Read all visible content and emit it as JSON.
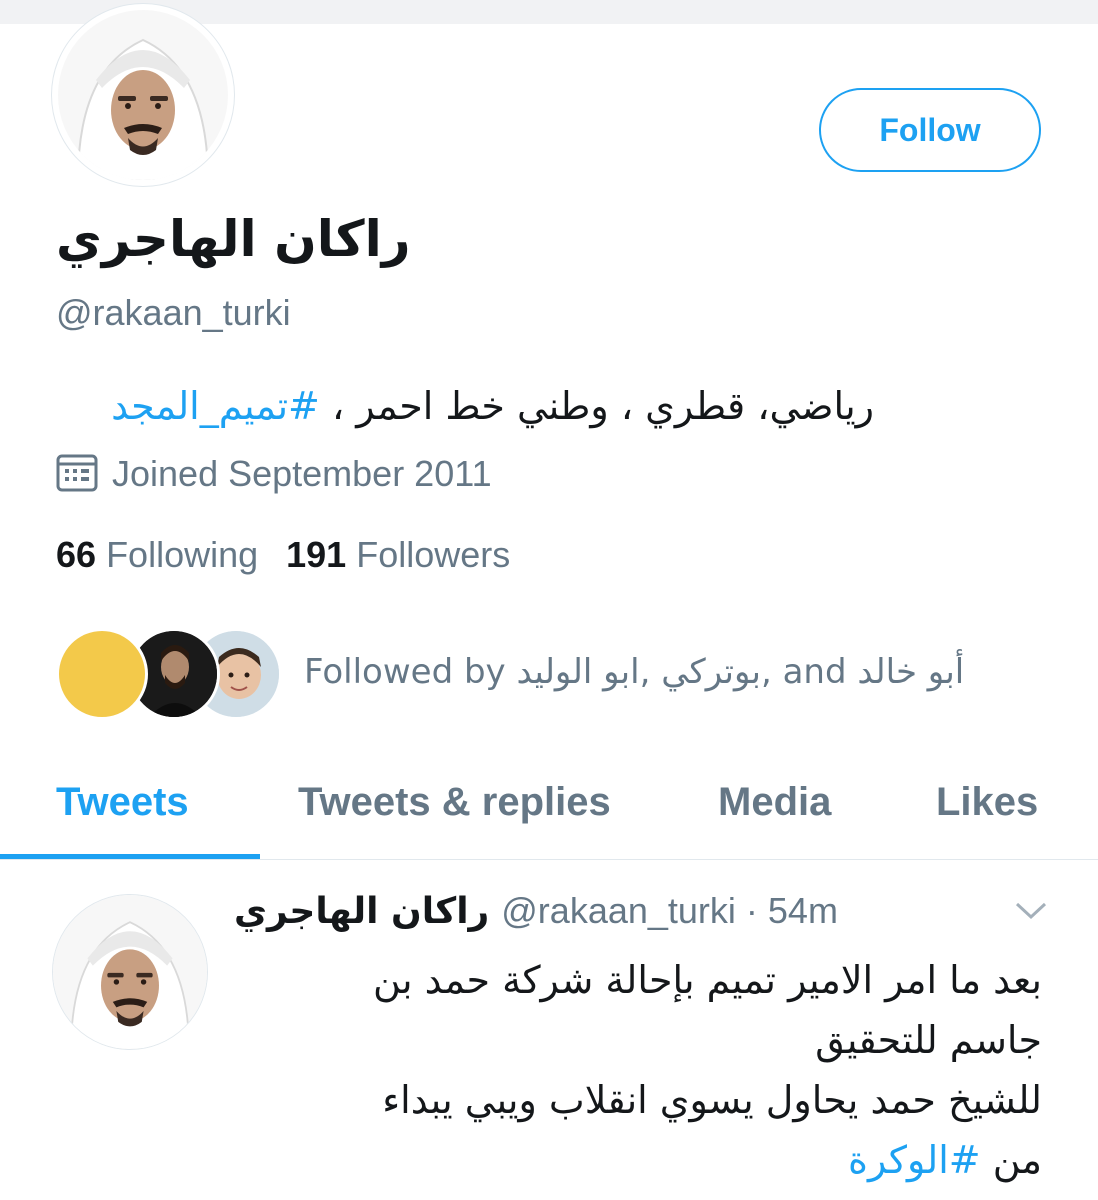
{
  "profile": {
    "display_name": "راكان الهاجري",
    "handle": "@rakaan_turki",
    "bio_text": "رياضي، قطري ، وطني خط احمر ، ",
    "bio_hashtag": "#تميم_المجد",
    "joined": "Joined September 2011",
    "following_count": "66",
    "following_label": "Following",
    "followers_count": "191",
    "followers_label": "Followers",
    "follow_button": "Follow",
    "followed_by": "Followed by بوتركي ,ابو الوليد, and أبو خالد"
  },
  "tabs": [
    {
      "label": "Tweets",
      "active": true
    },
    {
      "label": "Tweets & replies",
      "active": false
    },
    {
      "label": "Media",
      "active": false
    },
    {
      "label": "Likes",
      "active": false
    }
  ],
  "tweet": {
    "name": "راكان الهاجري",
    "handle_time": "@rakaan_turki · 54m",
    "line1": "بعد ما امر الامير تميم بإحالة شركة حمد بن",
    "line2": "جاسم للتحقيق",
    "line3": "للشيخ حمد يحاول يسوي انقلاب ويبي يبداء",
    "line4_prefix": "من ",
    "line4_hashtag": "#الوكرة"
  },
  "icons": {
    "calendar": "calendar-icon",
    "chevron": "chevron-down-icon"
  },
  "colors": {
    "accent": "#1da1f2",
    "secondary_text": "#657786",
    "primary_text": "#14171a"
  }
}
